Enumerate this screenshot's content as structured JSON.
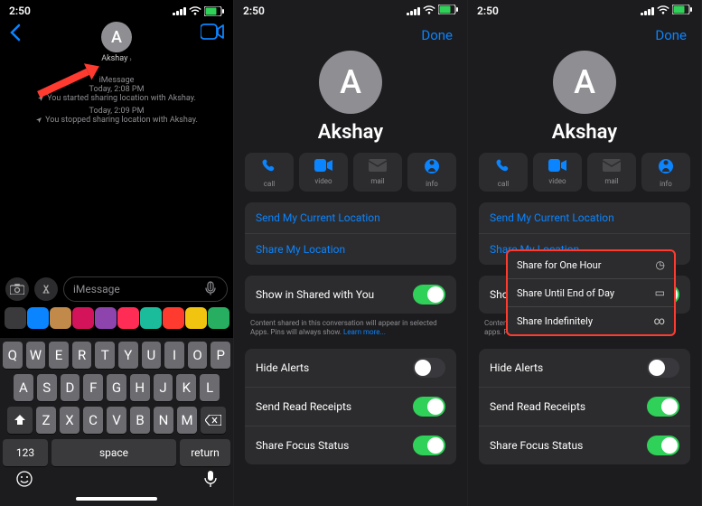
{
  "status": {
    "time": "2:50"
  },
  "panel1": {
    "contact": "Akshay",
    "avatar_letter": "A",
    "msg_header1": "iMessage\nToday, 2:08 PM",
    "msg_line1": "You started sharing location with Akshay.",
    "msg_header2": "Today, 2:09 PM",
    "msg_line2": "You stopped sharing location with Akshay.",
    "input_placeholder": "iMessage",
    "keyboard": {
      "row1": [
        "Q",
        "W",
        "E",
        "R",
        "T",
        "Y",
        "U",
        "I",
        "O",
        "P"
      ],
      "row2": [
        "A",
        "S",
        "D",
        "F",
        "G",
        "H",
        "J",
        "K",
        "L"
      ],
      "row3": [
        "Z",
        "X",
        "C",
        "V",
        "B",
        "N",
        "M"
      ],
      "k123": "123",
      "space": "space",
      "return": "return"
    },
    "app_colors": [
      "#3a3a3c",
      "#0a84ff",
      "#c28a4a",
      "#d4145a",
      "#8e44ad",
      "#ff2d55",
      "#1abc9c",
      "#ff3b30",
      "#f1c40f",
      "#27ae60"
    ]
  },
  "contact_detail": {
    "name": "Akshay",
    "avatar_letter": "A",
    "done": "Done",
    "actions": {
      "call": "call",
      "video": "video",
      "mail": "mail",
      "info": "info"
    },
    "send_location": "Send My Current Location",
    "share_location": "Share My Location",
    "shared_with_you": "Show in Shared with You",
    "shared_caption": "Content shared in this conversation will appear in selected Apps. Pins will always show.",
    "learn_more": "Learn more...",
    "hide_alerts": "Hide Alerts",
    "read_receipts": "Send Read Receipts",
    "focus_status": "Share Focus Status",
    "show_trunc": "Show"
  },
  "popup": {
    "one_hour": "Share for One Hour",
    "end_of_day": "Share Until End of Day",
    "indefinitely": "Share Indefinitely"
  }
}
